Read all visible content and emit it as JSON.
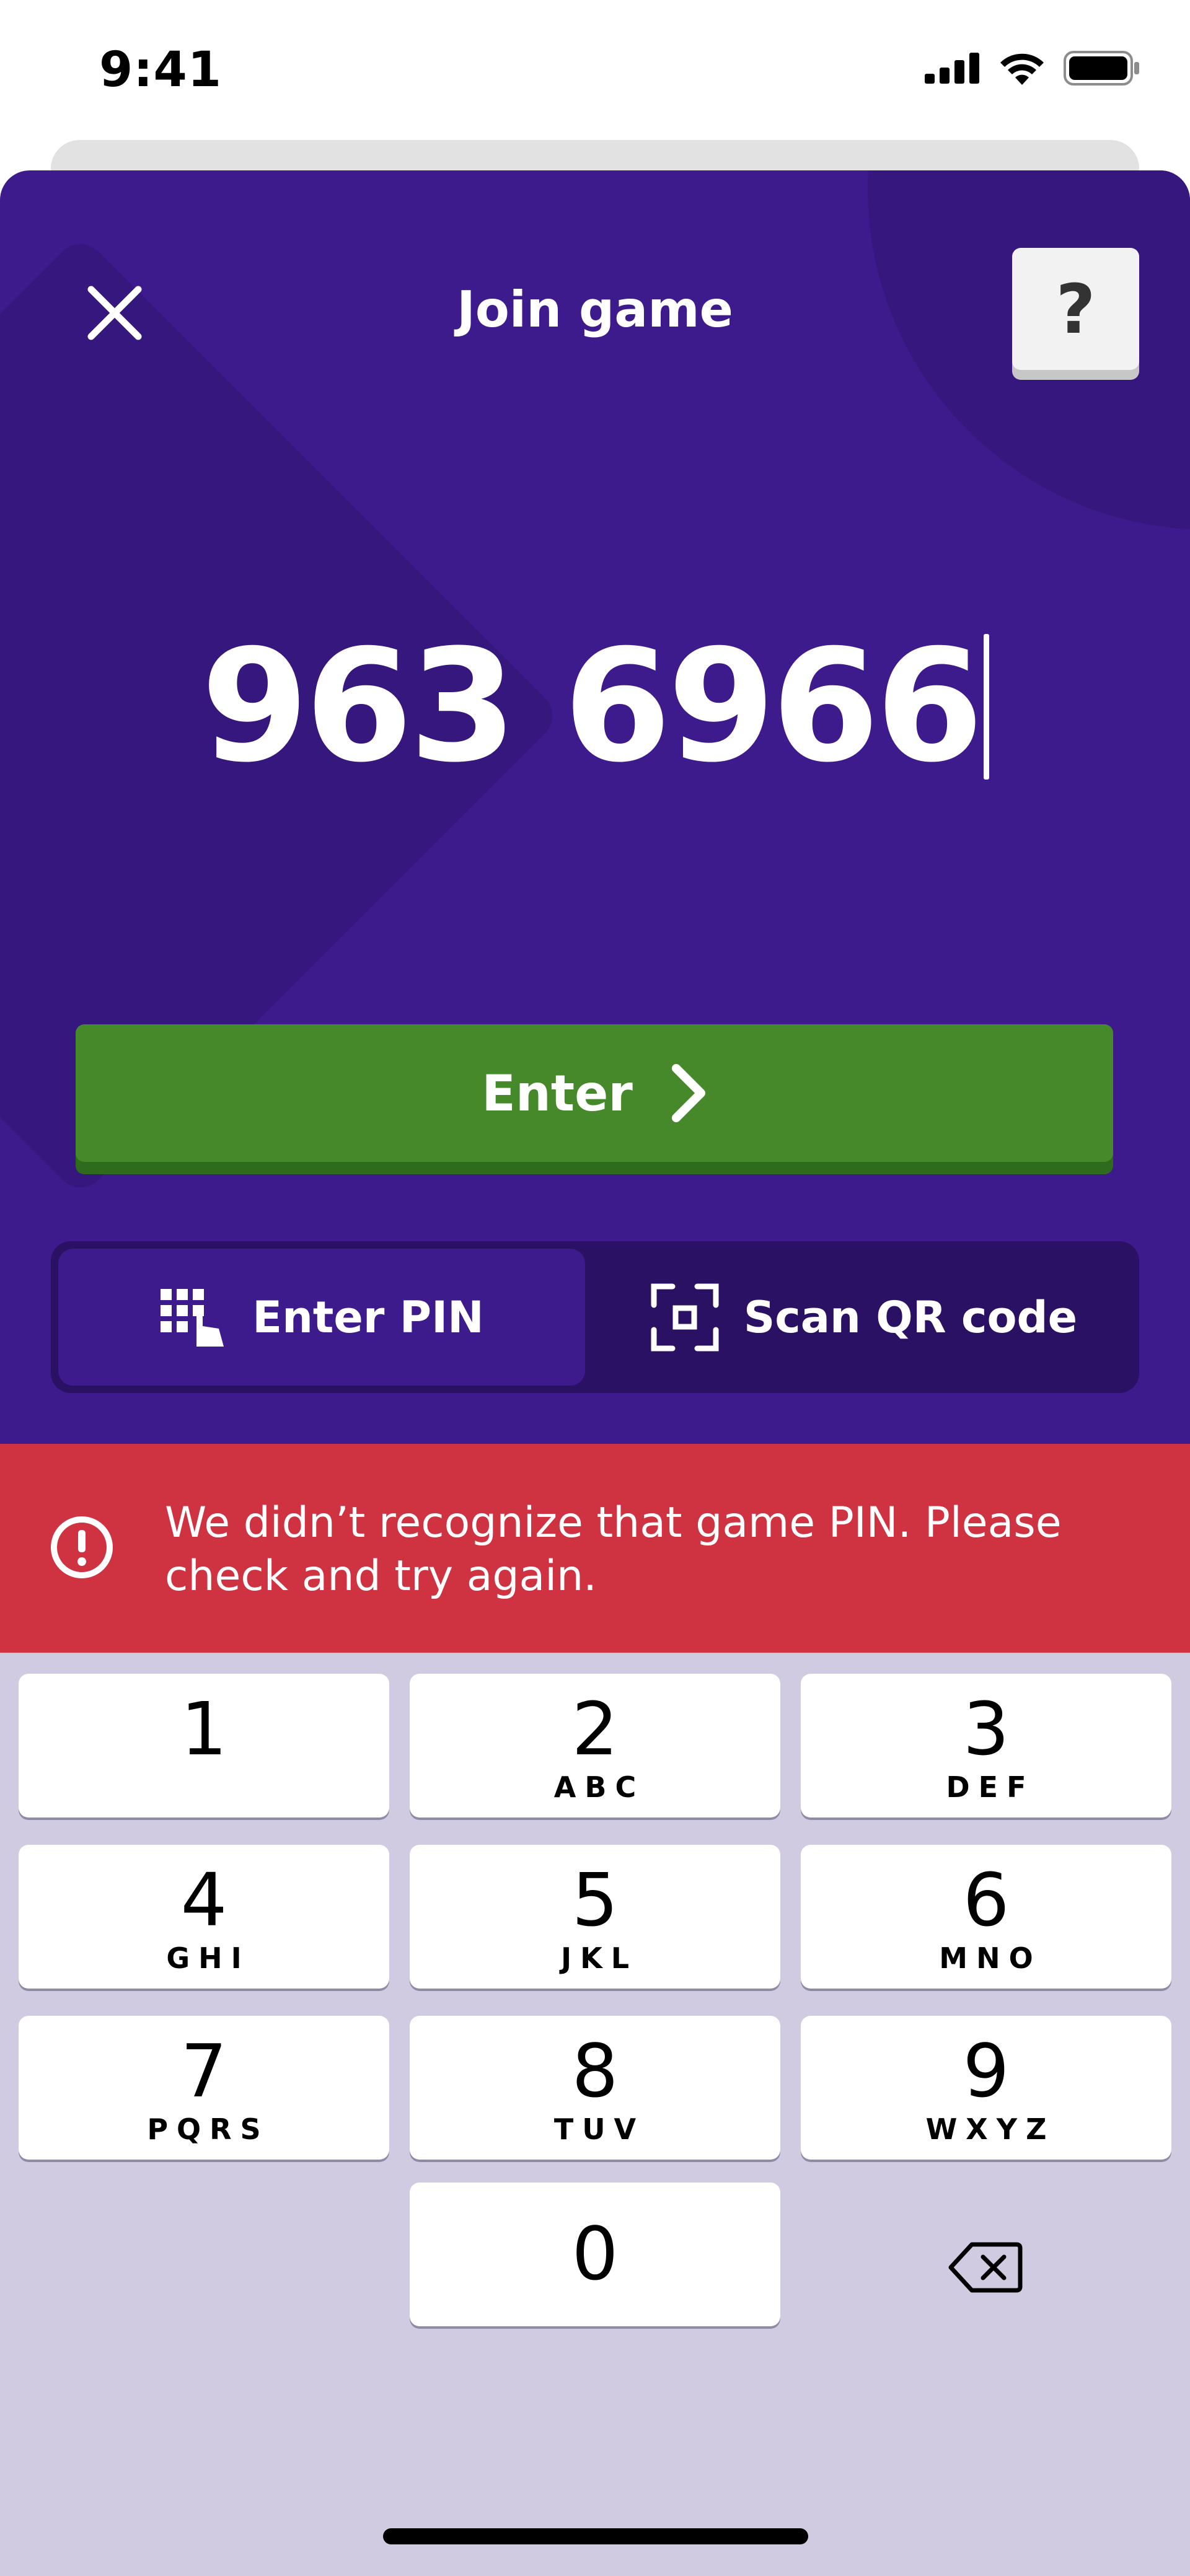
{
  "status_bar": {
    "time": "9:41"
  },
  "header": {
    "title": "Join game",
    "help_label": "?"
  },
  "pin": {
    "value": "963 6966"
  },
  "enter_button": {
    "label": "Enter"
  },
  "mode_toggle": {
    "pin_label": "Enter PIN",
    "qr_label": "Scan QR code",
    "selected": "Enter PIN"
  },
  "error": {
    "message": "We didn’t recognize that game PIN. Please check and try again."
  },
  "keypad": {
    "keys": [
      {
        "digit": "1",
        "letters": ""
      },
      {
        "digit": "2",
        "letters": "ABC"
      },
      {
        "digit": "3",
        "letters": "DEF"
      },
      {
        "digit": "4",
        "letters": "GHI"
      },
      {
        "digit": "5",
        "letters": "JKL"
      },
      {
        "digit": "6",
        "letters": "MNO"
      },
      {
        "digit": "7",
        "letters": "PQRS"
      },
      {
        "digit": "8",
        "letters": "TUV"
      },
      {
        "digit": "9",
        "letters": "WXYZ"
      },
      {
        "digit": "0",
        "letters": ""
      }
    ]
  },
  "colors": {
    "panel": "#3e1b8c",
    "enter_button": "#46892a",
    "error_banner": "#cf3341",
    "keypad_bg": "#d1cbe2"
  },
  "icons": [
    "close-icon",
    "help-icon",
    "chevron-right-icon",
    "keypad-grid-icon",
    "qr-scan-icon",
    "alert-circle-icon",
    "backspace-icon",
    "cellular-signal-icon",
    "wifi-icon",
    "battery-icon"
  ]
}
